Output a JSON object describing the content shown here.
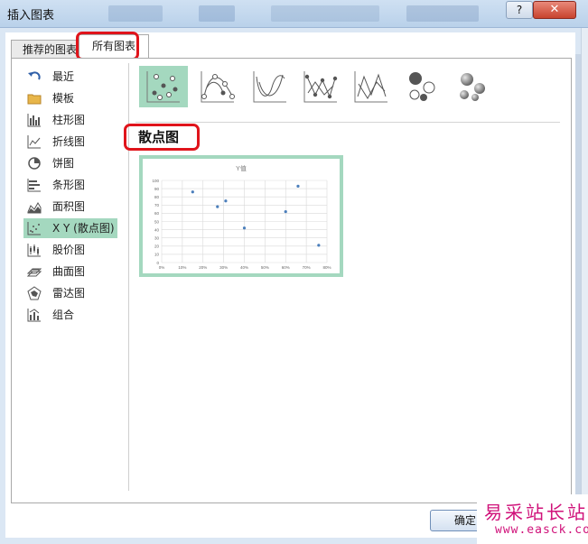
{
  "window": {
    "title": "插入图表",
    "help_label": "?",
    "close_label": "✕"
  },
  "tabs": [
    {
      "label": "推荐的图表"
    },
    {
      "label": "所有图表",
      "active": true
    }
  ],
  "sidebar": {
    "items": [
      {
        "label": "最近",
        "icon": "recent-icon"
      },
      {
        "label": "模板",
        "icon": "folder-icon"
      },
      {
        "label": "柱形图",
        "icon": "column-chart-icon"
      },
      {
        "label": "折线图",
        "icon": "line-chart-icon"
      },
      {
        "label": "饼图",
        "icon": "pie-chart-icon"
      },
      {
        "label": "条形图",
        "icon": "bar-chart-icon"
      },
      {
        "label": "面积图",
        "icon": "area-chart-icon"
      },
      {
        "label": "X Y (散点图)",
        "icon": "scatter-chart-icon",
        "selected": true
      },
      {
        "label": "股价图",
        "icon": "stock-chart-icon"
      },
      {
        "label": "曲面图",
        "icon": "surface-chart-icon"
      },
      {
        "label": "雷达图",
        "icon": "radar-chart-icon"
      },
      {
        "label": "组合",
        "icon": "combo-chart-icon"
      }
    ]
  },
  "subtypes": [
    {
      "icon": "scatter-icon",
      "selected": true
    },
    {
      "icon": "scatter-smooth-lines-markers-icon"
    },
    {
      "icon": "scatter-smooth-lines-icon"
    },
    {
      "icon": "scatter-straight-lines-markers-icon"
    },
    {
      "icon": "scatter-straight-lines-icon"
    },
    {
      "icon": "bubble-icon"
    },
    {
      "icon": "bubble-3d-icon"
    }
  ],
  "section_heading": "散点图",
  "preview": {
    "chart_data": {
      "type": "scatter",
      "title": "Y值",
      "xlim": [
        0,
        0.8
      ],
      "ylim": [
        0,
        100
      ],
      "x_ticks": [
        "0%",
        "10%",
        "20%",
        "30%",
        "40%",
        "50%",
        "60%",
        "70%",
        "80%"
      ],
      "y_ticks": [
        "0",
        "10",
        "20",
        "30",
        "40",
        "50",
        "60",
        "70",
        "80",
        "90",
        "100"
      ],
      "grid": true,
      "points": [
        {
          "x": 0.15,
          "y": 86
        },
        {
          "x": 0.27,
          "y": 68
        },
        {
          "x": 0.31,
          "y": 75
        },
        {
          "x": 0.4,
          "y": 42
        },
        {
          "x": 0.6,
          "y": 62
        },
        {
          "x": 0.66,
          "y": 93
        },
        {
          "x": 0.76,
          "y": 21
        }
      ],
      "marker_color": "#4a7ebb"
    }
  },
  "footer": {
    "ok_label": "确定"
  },
  "watermark": {
    "line1": "易采站长站",
    "line2": "www.easck.com"
  },
  "colors": {
    "selection": "#a4d8bf",
    "annotation_red": "#e0141b",
    "titlebar": "#c4d8ee"
  }
}
